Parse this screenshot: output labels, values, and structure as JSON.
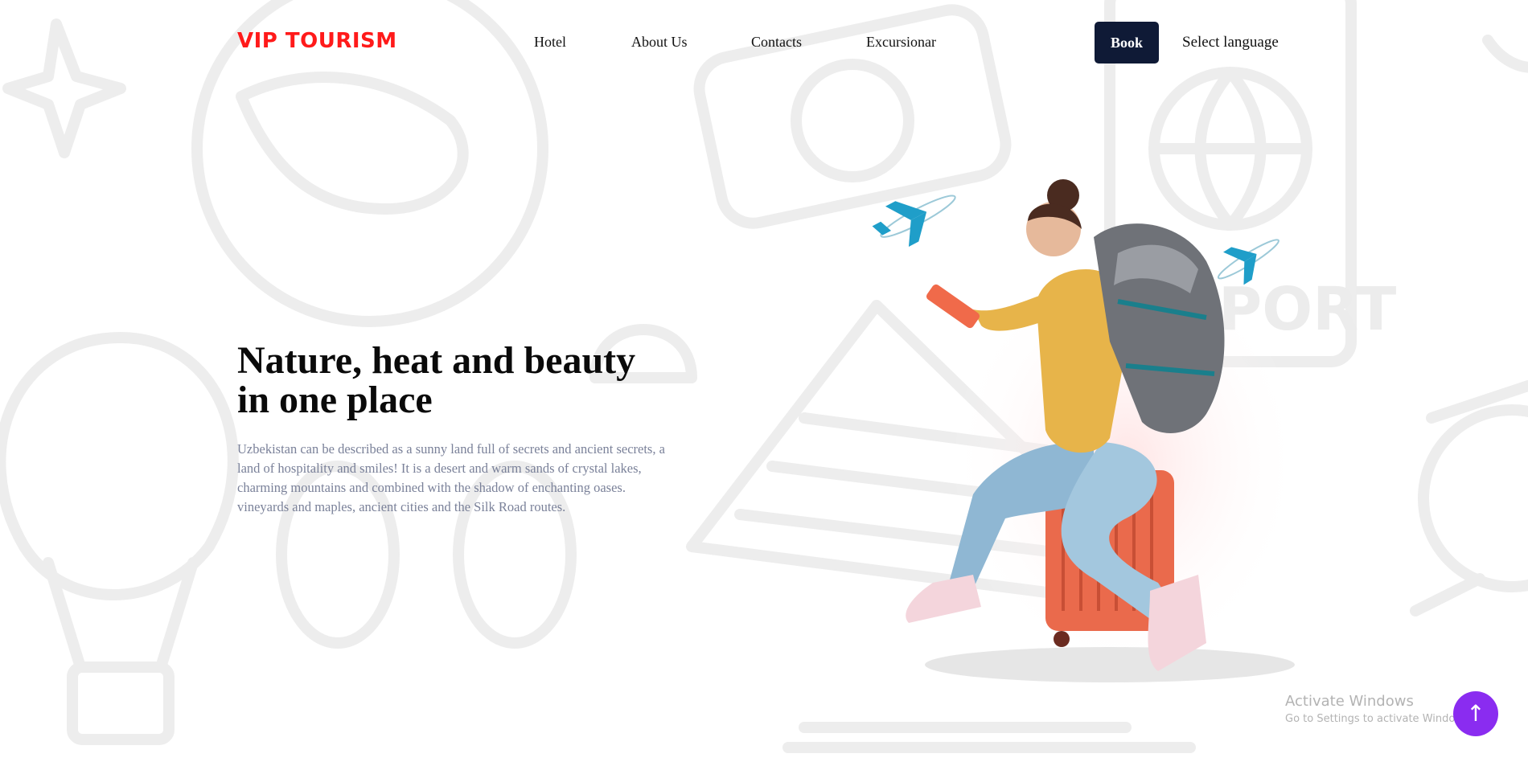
{
  "brand": {
    "logo_text": "VIP TOURISM",
    "logo_color": "#ff1a1a"
  },
  "nav": {
    "links": [
      {
        "label": "Hotel"
      },
      {
        "label": "About Us"
      },
      {
        "label": "Contacts"
      },
      {
        "label": "Excursionar"
      }
    ],
    "book_label": "Book",
    "language_label": "Select language"
  },
  "hero": {
    "title_line1": "Nature, heat and beauty",
    "title_line2": "in one place",
    "description": "Uzbekistan can be described as a sunny land full of secrets and ancient secrets, a land of hospitality and smiles! It is a desert and warm sands of crystal lakes, charming mountains and combined with the shadow of enchanting oases. vineyards and maples, ancient cities and the Silk Road routes."
  },
  "watermark": {
    "title": "Activate Windows",
    "subtitle": "Go to Settings to activate Windows."
  },
  "scroll_top": {
    "glyph": "↑",
    "color": "#8a2cf0"
  },
  "background_doodle_text": "PORT",
  "colors": {
    "button_bg": "#0f1a36",
    "text_muted": "#7a8199",
    "doodle": "#ececec"
  }
}
